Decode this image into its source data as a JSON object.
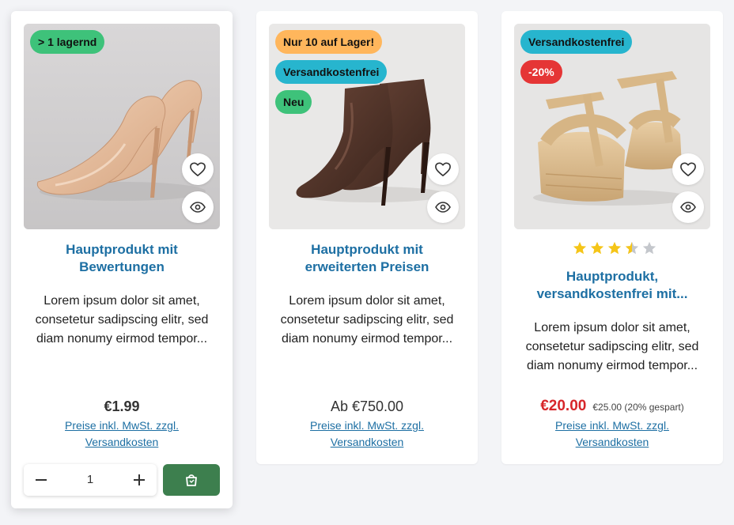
{
  "colors": {
    "link": "#1d6fa3",
    "badge_green": "#3ec27a",
    "badge_orange": "#ffb65c",
    "badge_teal": "#27b5ce",
    "badge_red": "#e53535",
    "buy_button": "#3d7f4e",
    "star": "#f5c518"
  },
  "products": [
    {
      "badges": [
        {
          "label": "> 1 lagernd",
          "color": "#3ec27a"
        }
      ],
      "image_icon": "nude-pumps-photo",
      "title_line1": "Hauptprodukt mit",
      "title_line2": "Bewertungen",
      "desc_line1": "Lorem ipsum dolor sit amet,",
      "desc_line2": "consetetur sadipscing elitr, sed",
      "desc_line3": "diam nonumy eirmod tempor...",
      "price": "€1.99",
      "tax_line1": "Preise inkl. MwSt. zzgl.",
      "tax_line2": "Versandkosten",
      "quantity": "1"
    },
    {
      "badges": [
        {
          "label": "Nur 10 auf Lager!",
          "color": "#ffb65c"
        },
        {
          "label": "Versandkostenfrei",
          "color": "#27b5ce"
        },
        {
          "label": "Neu",
          "color": "#3ec27a"
        }
      ],
      "image_icon": "brown-ankle-boots-photo",
      "title_line1": "Hauptprodukt mit",
      "title_line2": "erweiterten Preisen",
      "desc_line1": "Lorem ipsum dolor sit amet,",
      "desc_line2": "consetetur sadipscing elitr, sed",
      "desc_line3": "diam nonumy eirmod tempor...",
      "price": "Ab €750.00",
      "tax_line1": "Preise inkl. MwSt. zzgl.",
      "tax_line2": "Versandkosten"
    },
    {
      "badges": [
        {
          "label": "Versandkostenfrei",
          "color": "#27b5ce"
        },
        {
          "label": "-20%",
          "color": "#e53535"
        }
      ],
      "image_icon": "wedge-sandals-photo",
      "rating": 3.5,
      "rating_max": 5,
      "title_line1": "Hauptprodukt,",
      "title_line2": "versandkostenfrei mit...",
      "desc_line1": "Lorem ipsum dolor sit amet,",
      "desc_line2": "consetetur sadipscing elitr, sed",
      "desc_line3": "diam nonumy eirmod tempor...",
      "price": "€20.00",
      "old_price": "€25.00 (20% gespart)",
      "tax_line1": "Preise inkl. MwSt. zzgl.",
      "tax_line2": "Versandkosten"
    }
  ]
}
